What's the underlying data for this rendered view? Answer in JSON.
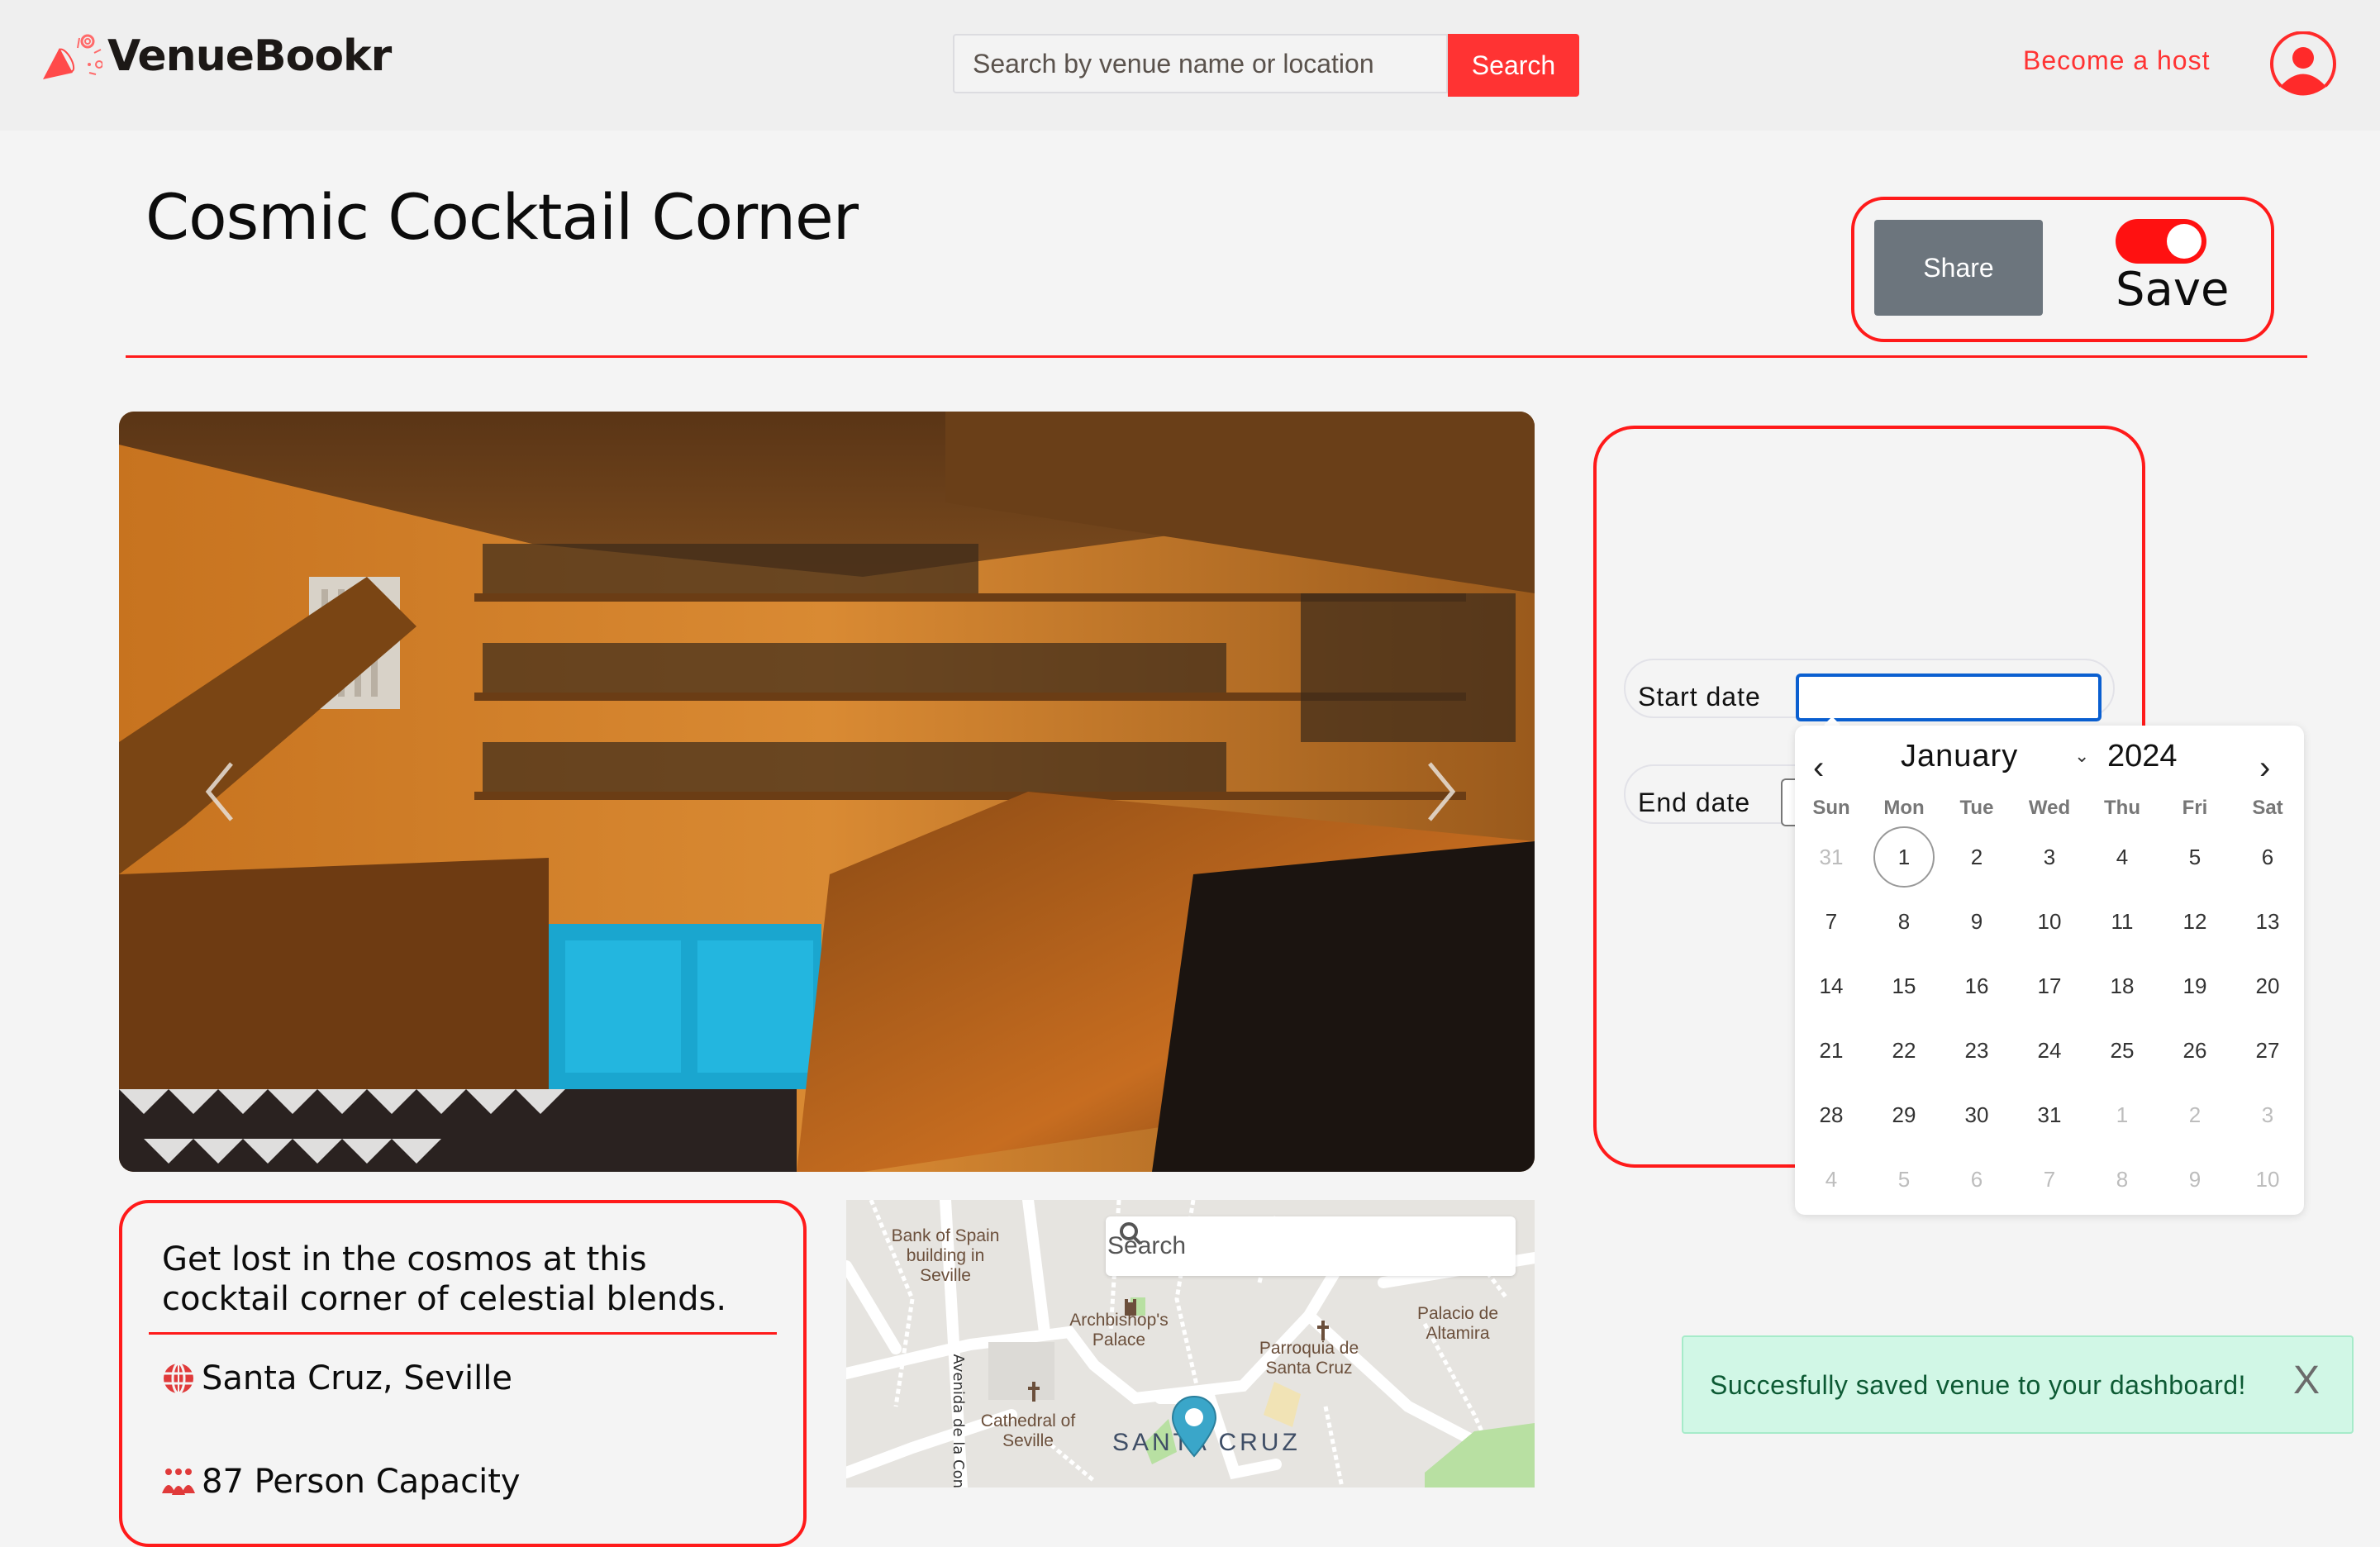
{
  "app": {
    "name": "VenueBookr"
  },
  "header": {
    "logo_text": "VenueBookr",
    "search_placeholder": "Search by venue name or location",
    "search_value": "",
    "search_button": "Search",
    "become_host": "Become a host",
    "profile_icon": "user-circle-icon"
  },
  "venue": {
    "title": "Cosmic Cocktail Corner",
    "share_label": "Share",
    "save_label": "Save",
    "save_toggle_on": true,
    "description": "Get lost in the cosmos at this cocktail corner of celestial blends.",
    "location": "Santa Cruz, Seville",
    "capacity": "87 Person Capacity"
  },
  "carousel": {
    "prev_icon": "chevron-left-icon",
    "next_icon": "chevron-right-icon",
    "image_alt": "Bar interior with wooden shelves of bottles and turquoise counter"
  },
  "booking": {
    "start_label": "Start date",
    "start_value": "",
    "end_label": "End date",
    "end_value": ""
  },
  "calendar": {
    "month": "January",
    "year": "2024",
    "weekdays": [
      "Sun",
      "Mon",
      "Tue",
      "Wed",
      "Thu",
      "Fri",
      "Sat"
    ],
    "weeks": [
      [
        {
          "d": "31",
          "m": true
        },
        {
          "d": "1",
          "today": true
        },
        {
          "d": "2"
        },
        {
          "d": "3"
        },
        {
          "d": "4"
        },
        {
          "d": "5"
        },
        {
          "d": "6"
        }
      ],
      [
        {
          "d": "7"
        },
        {
          "d": "8"
        },
        {
          "d": "9"
        },
        {
          "d": "10"
        },
        {
          "d": "11"
        },
        {
          "d": "12"
        },
        {
          "d": "13"
        }
      ],
      [
        {
          "d": "14"
        },
        {
          "d": "15"
        },
        {
          "d": "16"
        },
        {
          "d": "17"
        },
        {
          "d": "18"
        },
        {
          "d": "19"
        },
        {
          "d": "20"
        }
      ],
      [
        {
          "d": "21"
        },
        {
          "d": "22"
        },
        {
          "d": "23"
        },
        {
          "d": "24"
        },
        {
          "d": "25"
        },
        {
          "d": "26"
        },
        {
          "d": "27"
        }
      ],
      [
        {
          "d": "28"
        },
        {
          "d": "29"
        },
        {
          "d": "30"
        },
        {
          "d": "31"
        },
        {
          "d": "1",
          "m": true
        },
        {
          "d": "2",
          "m": true
        },
        {
          "d": "3",
          "m": true
        }
      ],
      [
        {
          "d": "4",
          "m": true
        },
        {
          "d": "5",
          "m": true
        },
        {
          "d": "6",
          "m": true
        },
        {
          "d": "7",
          "m": true
        },
        {
          "d": "8",
          "m": true
        },
        {
          "d": "9",
          "m": true
        },
        {
          "d": "10",
          "m": true
        }
      ]
    ]
  },
  "map": {
    "search_placeholder": "Search",
    "labels": {
      "bank": "Bank of Spain building in Seville",
      "archbishop": "Archbishop's Palace",
      "parroquia": "Parroquia de Santa Cruz",
      "palacio": "Palacio de Altamira",
      "cathedral": "Cathedral of Seville",
      "avenida": "Avenida de la Constit",
      "district": "SANTA CRUZ"
    }
  },
  "toast": {
    "message": "Succesfully saved venue to your dashboard!",
    "close_label": "X"
  },
  "colors": {
    "brand_red": "#ff3333",
    "accent_red": "#ff1a1a",
    "share_gray": "#6c757d",
    "focus_blue": "#0a5fd0",
    "toast_bg": "#d1f7e6",
    "toast_text": "#0d5a34"
  }
}
